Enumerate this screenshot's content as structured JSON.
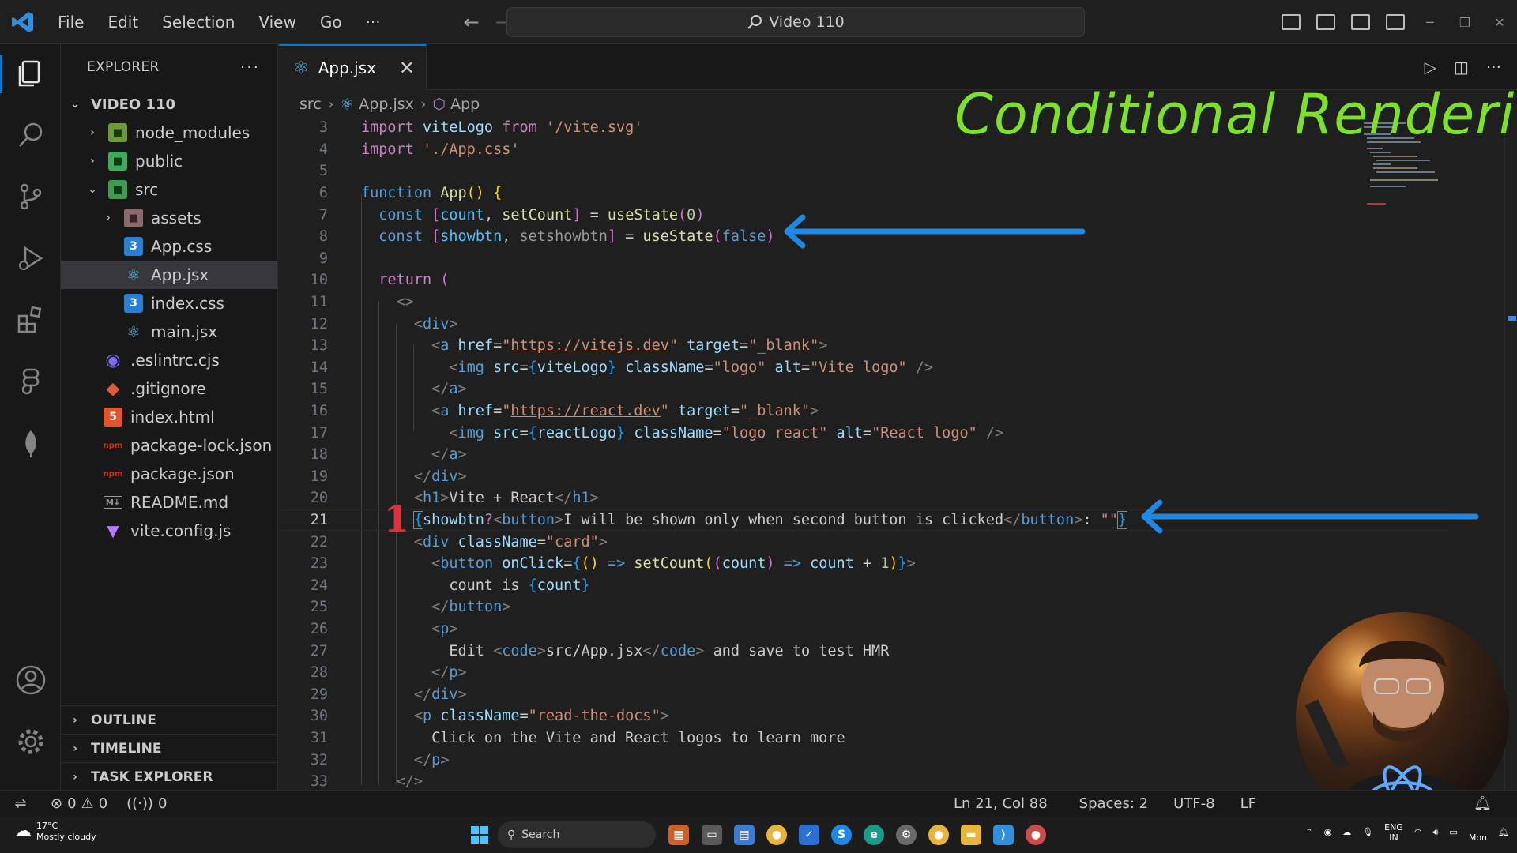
{
  "menu": {
    "items": [
      "File",
      "Edit",
      "Selection",
      "View",
      "Go",
      "···"
    ]
  },
  "command_center": {
    "text": "Video 110"
  },
  "sidebar": {
    "title": "EXPLORER",
    "more": "···",
    "root": "VIDEO 110",
    "items": [
      {
        "label": "node_modules",
        "icon": "folder-node-icon"
      },
      {
        "label": "public",
        "icon": "folder-public-icon"
      },
      {
        "label": "src",
        "icon": "folder-src-icon"
      },
      {
        "label": "assets",
        "icon": "folder-assets-icon"
      },
      {
        "label": "App.css",
        "icon": "css-file-icon"
      },
      {
        "label": "App.jsx",
        "icon": "react-file-icon"
      },
      {
        "label": "index.css",
        "icon": "css-file-icon"
      },
      {
        "label": "main.jsx",
        "icon": "react-file-icon"
      },
      {
        "label": ".eslintrc.cjs",
        "icon": "eslint-file-icon"
      },
      {
        "label": ".gitignore",
        "icon": "git-file-icon"
      },
      {
        "label": "index.html",
        "icon": "html-file-icon"
      },
      {
        "label": "package-lock.json",
        "icon": "npm-file-icon"
      },
      {
        "label": "package.json",
        "icon": "npm-file-icon"
      },
      {
        "label": "README.md",
        "icon": "markdown-file-icon"
      },
      {
        "label": "vite.config.js",
        "icon": "vite-file-icon"
      }
    ],
    "sections": [
      "OUTLINE",
      "TIMELINE",
      "TASK EXPLORER"
    ]
  },
  "tab": {
    "label": "App.jsx",
    "close": "✕"
  },
  "breadcrumb": [
    "src",
    "App.jsx",
    "App"
  ],
  "annotation": {
    "title": "Conditional Rendering",
    "marker": "1"
  },
  "status": {
    "errors": "0",
    "warnings": "0",
    "ports": "0",
    "position": "Ln 21, Col 88",
    "spaces": "Spaces: 2",
    "encoding": "UTF-8",
    "eol": "LF"
  },
  "taskbar": {
    "temp": "17°C",
    "weather": "Mostly cloudy",
    "search": "Search",
    "lang_top": "ENG",
    "lang_bottom": "IN",
    "day": "Mon"
  },
  "colors": {
    "accent": "#0078d4",
    "annotation_green": "#7fe028",
    "arrow_blue": "#1e88e5",
    "marker_red": "#e0303a"
  }
}
